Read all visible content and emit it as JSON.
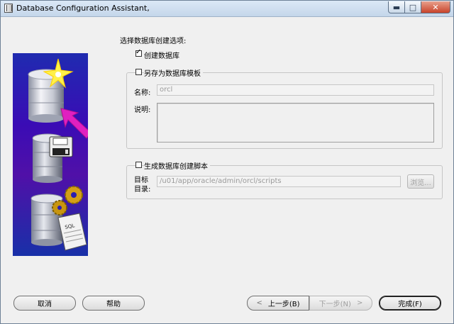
{
  "window": {
    "title": "Database Configuration Assistant,",
    "controls": {
      "minimize": "▬",
      "maximize": "□",
      "close": "✕"
    }
  },
  "options": {
    "heading": "选择数据库创建选项:",
    "create_db": {
      "label": "创建数据库",
      "checked": true
    },
    "save_template": {
      "label": "另存为数据库模板",
      "checked": false,
      "name_label": "名称:",
      "name_value": "orcl",
      "desc_label": "说明:",
      "desc_value": ""
    },
    "gen_scripts": {
      "label": "生成数据库创建脚本",
      "checked": false,
      "dir_label_line1": "目标",
      "dir_label_line2": "目录:",
      "dir_value": "/u01/app/oracle/admin/orcl/scripts",
      "browse_label": "浏览..."
    }
  },
  "footer": {
    "cancel": "取消",
    "help": "帮助",
    "back": "上一步(B)",
    "next": "下一步(N)",
    "finish": "完成(F)"
  },
  "colors": {
    "art_background": "#2a1fb0",
    "arrow": "#e020c0",
    "star": "#fff04a"
  }
}
